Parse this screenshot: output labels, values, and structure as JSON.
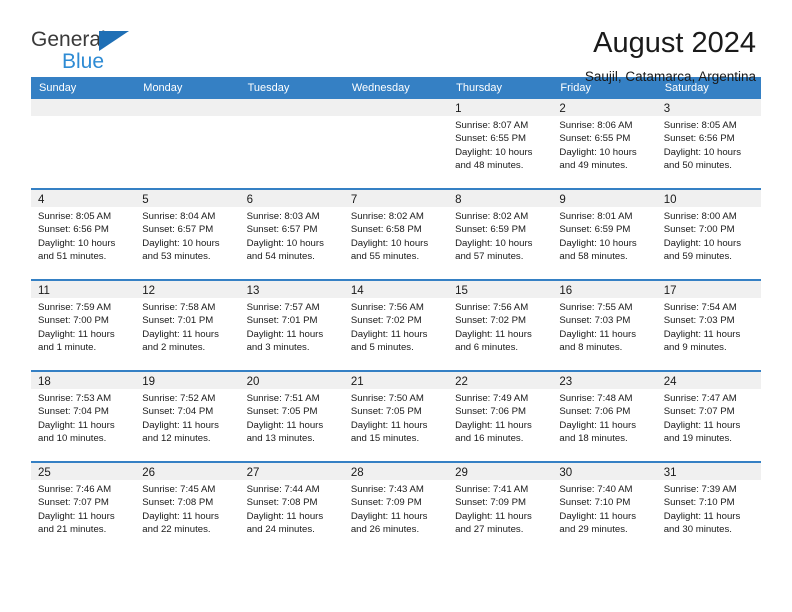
{
  "logo": {
    "word1": "General",
    "word2": "Blue",
    "triangle_color": "#1f6fb5",
    "blue_color": "#2e8bd4"
  },
  "header": {
    "title": "August 2024",
    "subtitle": "Saujil, Catamarca, Argentina"
  },
  "calendar": {
    "header_bg": "#3580c4",
    "day_band_bg": "#f0f0f0",
    "weekdays": [
      "Sunday",
      "Monday",
      "Tuesday",
      "Wednesday",
      "Thursday",
      "Friday",
      "Saturday"
    ],
    "weeks": [
      [
        {
          "day": "",
          "lines": []
        },
        {
          "day": "",
          "lines": []
        },
        {
          "day": "",
          "lines": []
        },
        {
          "day": "",
          "lines": []
        },
        {
          "day": "1",
          "lines": [
            "Sunrise: 8:07 AM",
            "Sunset: 6:55 PM",
            "Daylight: 10 hours",
            "and 48 minutes."
          ]
        },
        {
          "day": "2",
          "lines": [
            "Sunrise: 8:06 AM",
            "Sunset: 6:55 PM",
            "Daylight: 10 hours",
            "and 49 minutes."
          ]
        },
        {
          "day": "3",
          "lines": [
            "Sunrise: 8:05 AM",
            "Sunset: 6:56 PM",
            "Daylight: 10 hours",
            "and 50 minutes."
          ]
        }
      ],
      [
        {
          "day": "4",
          "lines": [
            "Sunrise: 8:05 AM",
            "Sunset: 6:56 PM",
            "Daylight: 10 hours",
            "and 51 minutes."
          ]
        },
        {
          "day": "5",
          "lines": [
            "Sunrise: 8:04 AM",
            "Sunset: 6:57 PM",
            "Daylight: 10 hours",
            "and 53 minutes."
          ]
        },
        {
          "day": "6",
          "lines": [
            "Sunrise: 8:03 AM",
            "Sunset: 6:57 PM",
            "Daylight: 10 hours",
            "and 54 minutes."
          ]
        },
        {
          "day": "7",
          "lines": [
            "Sunrise: 8:02 AM",
            "Sunset: 6:58 PM",
            "Daylight: 10 hours",
            "and 55 minutes."
          ]
        },
        {
          "day": "8",
          "lines": [
            "Sunrise: 8:02 AM",
            "Sunset: 6:59 PM",
            "Daylight: 10 hours",
            "and 57 minutes."
          ]
        },
        {
          "day": "9",
          "lines": [
            "Sunrise: 8:01 AM",
            "Sunset: 6:59 PM",
            "Daylight: 10 hours",
            "and 58 minutes."
          ]
        },
        {
          "day": "10",
          "lines": [
            "Sunrise: 8:00 AM",
            "Sunset: 7:00 PM",
            "Daylight: 10 hours",
            "and 59 minutes."
          ]
        }
      ],
      [
        {
          "day": "11",
          "lines": [
            "Sunrise: 7:59 AM",
            "Sunset: 7:00 PM",
            "Daylight: 11 hours",
            "and 1 minute."
          ]
        },
        {
          "day": "12",
          "lines": [
            "Sunrise: 7:58 AM",
            "Sunset: 7:01 PM",
            "Daylight: 11 hours",
            "and 2 minutes."
          ]
        },
        {
          "day": "13",
          "lines": [
            "Sunrise: 7:57 AM",
            "Sunset: 7:01 PM",
            "Daylight: 11 hours",
            "and 3 minutes."
          ]
        },
        {
          "day": "14",
          "lines": [
            "Sunrise: 7:56 AM",
            "Sunset: 7:02 PM",
            "Daylight: 11 hours",
            "and 5 minutes."
          ]
        },
        {
          "day": "15",
          "lines": [
            "Sunrise: 7:56 AM",
            "Sunset: 7:02 PM",
            "Daylight: 11 hours",
            "and 6 minutes."
          ]
        },
        {
          "day": "16",
          "lines": [
            "Sunrise: 7:55 AM",
            "Sunset: 7:03 PM",
            "Daylight: 11 hours",
            "and 8 minutes."
          ]
        },
        {
          "day": "17",
          "lines": [
            "Sunrise: 7:54 AM",
            "Sunset: 7:03 PM",
            "Daylight: 11 hours",
            "and 9 minutes."
          ]
        }
      ],
      [
        {
          "day": "18",
          "lines": [
            "Sunrise: 7:53 AM",
            "Sunset: 7:04 PM",
            "Daylight: 11 hours",
            "and 10 minutes."
          ]
        },
        {
          "day": "19",
          "lines": [
            "Sunrise: 7:52 AM",
            "Sunset: 7:04 PM",
            "Daylight: 11 hours",
            "and 12 minutes."
          ]
        },
        {
          "day": "20",
          "lines": [
            "Sunrise: 7:51 AM",
            "Sunset: 7:05 PM",
            "Daylight: 11 hours",
            "and 13 minutes."
          ]
        },
        {
          "day": "21",
          "lines": [
            "Sunrise: 7:50 AM",
            "Sunset: 7:05 PM",
            "Daylight: 11 hours",
            "and 15 minutes."
          ]
        },
        {
          "day": "22",
          "lines": [
            "Sunrise: 7:49 AM",
            "Sunset: 7:06 PM",
            "Daylight: 11 hours",
            "and 16 minutes."
          ]
        },
        {
          "day": "23",
          "lines": [
            "Sunrise: 7:48 AM",
            "Sunset: 7:06 PM",
            "Daylight: 11 hours",
            "and 18 minutes."
          ]
        },
        {
          "day": "24",
          "lines": [
            "Sunrise: 7:47 AM",
            "Sunset: 7:07 PM",
            "Daylight: 11 hours",
            "and 19 minutes."
          ]
        }
      ],
      [
        {
          "day": "25",
          "lines": [
            "Sunrise: 7:46 AM",
            "Sunset: 7:07 PM",
            "Daylight: 11 hours",
            "and 21 minutes."
          ]
        },
        {
          "day": "26",
          "lines": [
            "Sunrise: 7:45 AM",
            "Sunset: 7:08 PM",
            "Daylight: 11 hours",
            "and 22 minutes."
          ]
        },
        {
          "day": "27",
          "lines": [
            "Sunrise: 7:44 AM",
            "Sunset: 7:08 PM",
            "Daylight: 11 hours",
            "and 24 minutes."
          ]
        },
        {
          "day": "28",
          "lines": [
            "Sunrise: 7:43 AM",
            "Sunset: 7:09 PM",
            "Daylight: 11 hours",
            "and 26 minutes."
          ]
        },
        {
          "day": "29",
          "lines": [
            "Sunrise: 7:41 AM",
            "Sunset: 7:09 PM",
            "Daylight: 11 hours",
            "and 27 minutes."
          ]
        },
        {
          "day": "30",
          "lines": [
            "Sunrise: 7:40 AM",
            "Sunset: 7:10 PM",
            "Daylight: 11 hours",
            "and 29 minutes."
          ]
        },
        {
          "day": "31",
          "lines": [
            "Sunrise: 7:39 AM",
            "Sunset: 7:10 PM",
            "Daylight: 11 hours",
            "and 30 minutes."
          ]
        }
      ]
    ]
  }
}
